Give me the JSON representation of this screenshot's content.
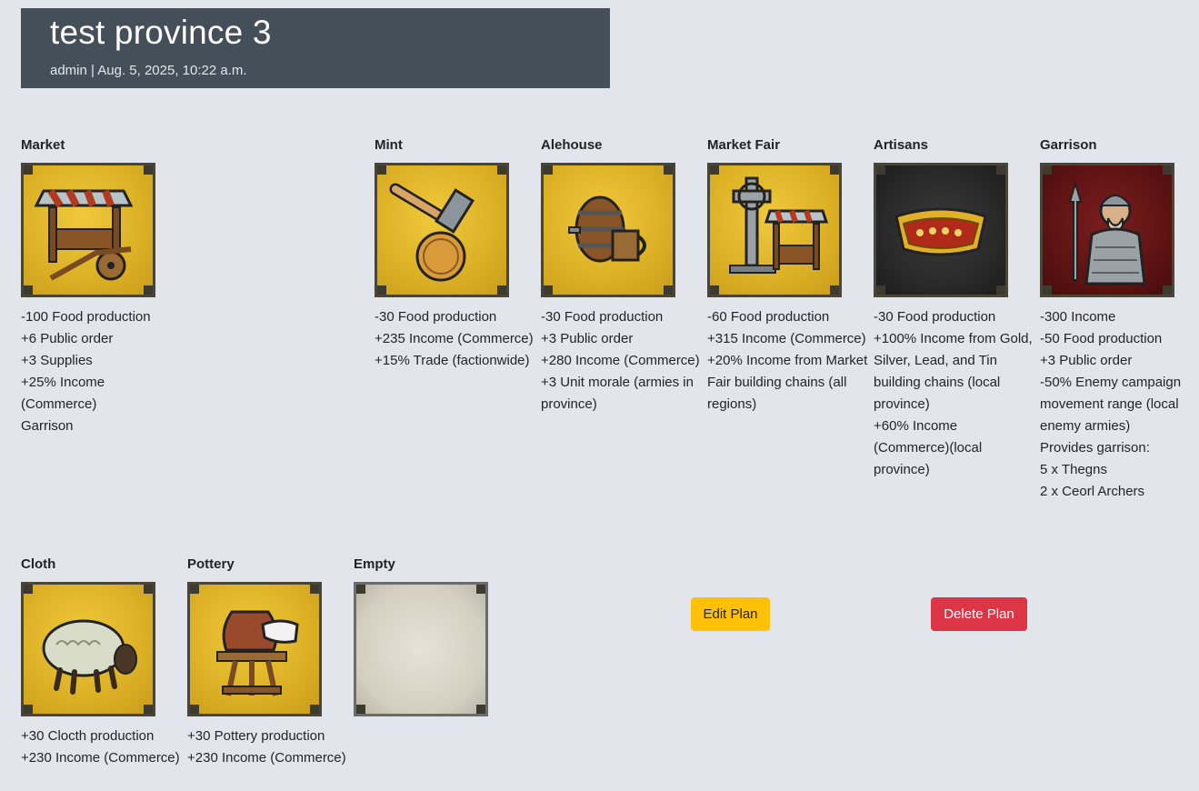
{
  "header": {
    "title": "test province 3",
    "meta": "admin | Aug. 5, 2025, 10:22 a.m."
  },
  "buildings": [
    {
      "name": "Market",
      "icon": "market-stall-icon",
      "effects": [
        "-100 Food production",
        "+6 Public order",
        "+3 Supplies",
        "+25% Income (Commerce)",
        "Garrison"
      ]
    },
    {
      "name": "Mint",
      "icon": "hammer-coin-icon",
      "effects": [
        "-30 Food production",
        "+235 Income (Commerce)",
        "+15% Trade (factionwide)"
      ]
    },
    {
      "name": "Alehouse",
      "icon": "barrel-tankard-icon",
      "effects": [
        "-30 Food production",
        "+3 Public order",
        "+280 Income (Commerce)",
        "+3 Unit morale (armies in province)"
      ]
    },
    {
      "name": "Market Fair",
      "icon": "cross-stall-icon",
      "effects": [
        "-60 Food production",
        "+315 Income (Commerce)",
        "+20% Income from Market Fair building chains (all regions)"
      ]
    },
    {
      "name": "Artisans",
      "icon": "gold-bracelet-icon",
      "effects": [
        "-30 Food production",
        "+100% Income from Gold, Silver, Lead, and Tin building chains (local province)",
        "+60% Income (Commerce)(local province)"
      ]
    },
    {
      "name": "Garrison",
      "icon": "spearman-icon",
      "effects": [
        "-300 Income",
        "-50 Food production",
        "+3 Public order",
        "-50% Enemy campaign movement range (local enemy armies)",
        "Provides garrison:",
        "5 x Thegns",
        "2 x Ceorl Archers"
      ]
    },
    {
      "name": "Cloth",
      "icon": "sheep-icon",
      "effects": [
        "+30 Clocth production",
        "+230 Income (Commerce)"
      ]
    },
    {
      "name": "Pottery",
      "icon": "pot-hand-icon",
      "effects": [
        "+30 Pottery production",
        "+230 Income (Commerce)"
      ]
    },
    {
      "name": "Empty",
      "icon": "empty-slot-icon",
      "effects": []
    }
  ],
  "actions": {
    "edit_label": "Edit Plan",
    "delete_label": "Delete Plan"
  }
}
